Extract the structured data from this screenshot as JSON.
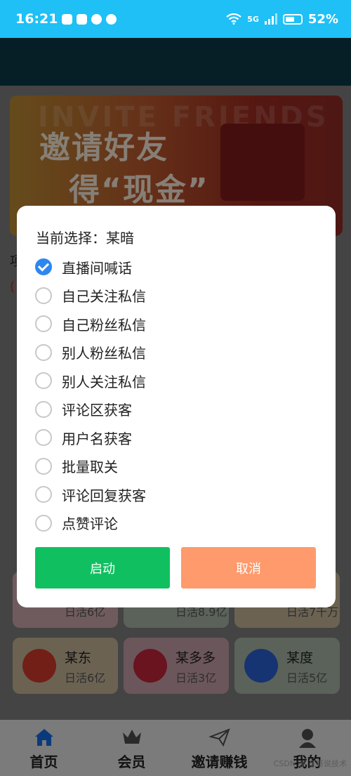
{
  "status_bar": {
    "time": "16:21",
    "network": "5G",
    "battery": "52%"
  },
  "banner": {
    "ghost_text": "INVITE FRIENDS",
    "line1": "邀请好友",
    "line2": "得“现金”"
  },
  "background_cards": [
    {
      "name": "",
      "stat": "日活6亿",
      "bg": "#caa7a9"
    },
    {
      "name": "",
      "stat": "日活8.9亿",
      "bg": "#a4b3a4"
    },
    {
      "name": "",
      "stat": "日活7千万",
      "bg": "#c4b295"
    },
    {
      "name": "某东",
      "stat": "日活6亿",
      "bg": "#c4b295"
    },
    {
      "name": "某多多",
      "stat": "日活3亿",
      "bg": "#c39da6"
    },
    {
      "name": "某度",
      "stat": "日活5亿",
      "bg": "#a4b3a4"
    }
  ],
  "dialog": {
    "title": "当前选择：某暗",
    "options": [
      {
        "label": "直播间喊话",
        "checked": true
      },
      {
        "label": "自己关注私信",
        "checked": false
      },
      {
        "label": "自己粉丝私信",
        "checked": false
      },
      {
        "label": "别人粉丝私信",
        "checked": false
      },
      {
        "label": "别人关注私信",
        "checked": false
      },
      {
        "label": "评论区获客",
        "checked": false
      },
      {
        "label": "用户名获客",
        "checked": false
      },
      {
        "label": "批量取关",
        "checked": false
      },
      {
        "label": "评论回复获客",
        "checked": false
      },
      {
        "label": "点赞评论",
        "checked": false
      }
    ],
    "start_label": "启动",
    "cancel_label": "取消",
    "start_color": "#10c060",
    "cancel_color": "#ff9a6c",
    "check_color": "#2e86f0"
  },
  "tabs": [
    {
      "label": "首页",
      "icon": "home-icon",
      "active": true
    },
    {
      "label": "会员",
      "icon": "crown-icon",
      "active": false
    },
    {
      "label": "邀请赚钱",
      "icon": "paper-plane-icon",
      "active": false
    },
    {
      "label": "我的",
      "icon": "person-icon",
      "active": false
    }
  ],
  "watermark": "CSDN @ 东哥说技术"
}
